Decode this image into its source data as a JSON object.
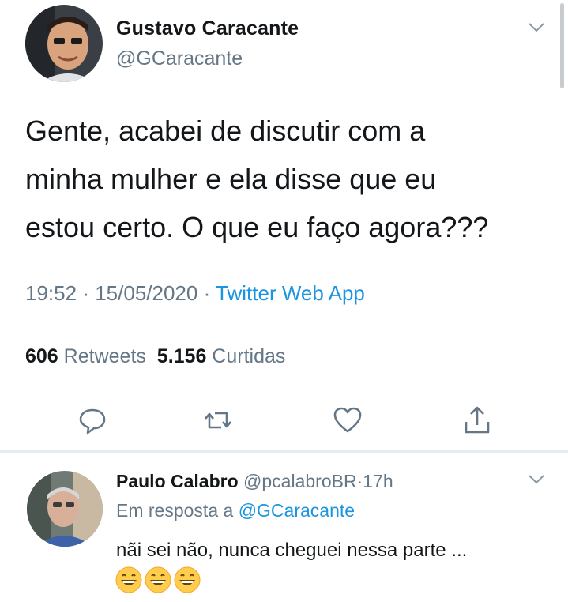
{
  "tweet": {
    "author_name": "Gustavo Caracante",
    "author_handle": "@GCaracante",
    "text": "Gente, acabei de discutir com a minha mulher e ela disse que eu estou certo. O que eu faço agora???",
    "text_lines": [
      "Gente, acabei de discutir com a",
      "minha mulher e ela disse que eu",
      "estou certo. O que eu faço agora???"
    ],
    "time": "19:52",
    "date": "15/05/2020",
    "separator": "·",
    "source": "Twitter Web App",
    "retweets_count": "606",
    "retweets_label": "Retweets",
    "likes_count": "5.156",
    "likes_label": "Curtidas",
    "icons": [
      "reply-icon",
      "retweet-icon",
      "like-icon",
      "share-icon"
    ]
  },
  "reply": {
    "author_name": "Paulo Calabro",
    "author_handle": "@pcalabroBR",
    "separator": "·",
    "age": "17h",
    "in_reply_prefix": "Em resposta a",
    "in_reply_handle": "@GCaracante",
    "text": "nãi sei não, nunca cheguei nessa parte ...",
    "emojis": [
      "grinning-face",
      "grinning-face",
      "grinning-face"
    ]
  },
  "colors": {
    "text_primary": "#14171a",
    "text_secondary": "#657786",
    "link_blue": "#1b95e0",
    "divider": "#e1e8ed",
    "emoji_yellow": "#ffcc4d"
  }
}
